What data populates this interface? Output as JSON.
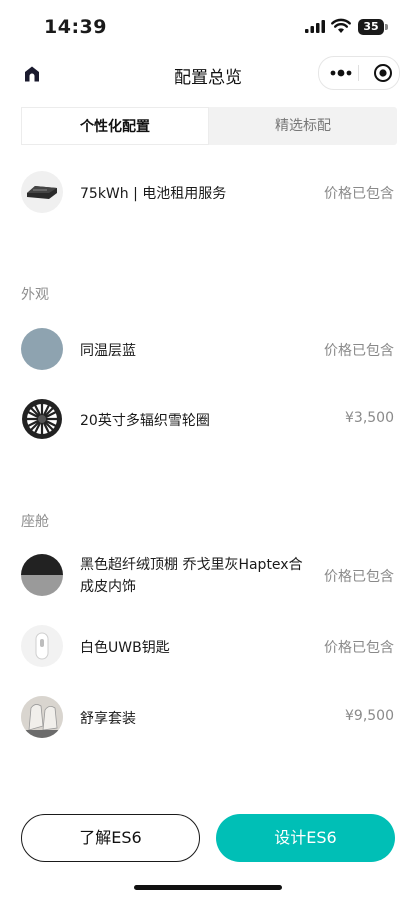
{
  "status_bar": {
    "time": "14:39",
    "battery": "35"
  },
  "nav": {
    "title": "配置总览"
  },
  "tabs": [
    {
      "label": "个性化配置",
      "active": true
    },
    {
      "label": "精选标配",
      "active": false
    }
  ],
  "battery_item": {
    "label": "75kWh | 电池租用服务",
    "price": "价格已包含"
  },
  "sections": {
    "exterior": {
      "title": "外观",
      "items": [
        {
          "label": "同温层蓝",
          "price": "价格已包含"
        },
        {
          "label": "20英寸多辐织雪轮圈",
          "price": "¥3,500"
        }
      ]
    },
    "cabin": {
      "title": "座舱",
      "items": [
        {
          "label": "黑色超纤绒顶棚 乔戈里灰Haptex合成皮内饰",
          "price": "价格已包含"
        },
        {
          "label": "白色UWB钥匙",
          "price": "价格已包含"
        },
        {
          "label": "舒享套装",
          "price": "¥9,500"
        }
      ]
    }
  },
  "buttons": {
    "learn": "了解ES6",
    "design": "设计ES6"
  },
  "colors": {
    "accent": "#00bfb6",
    "stratosphere_blue": "#8ea3b0"
  }
}
